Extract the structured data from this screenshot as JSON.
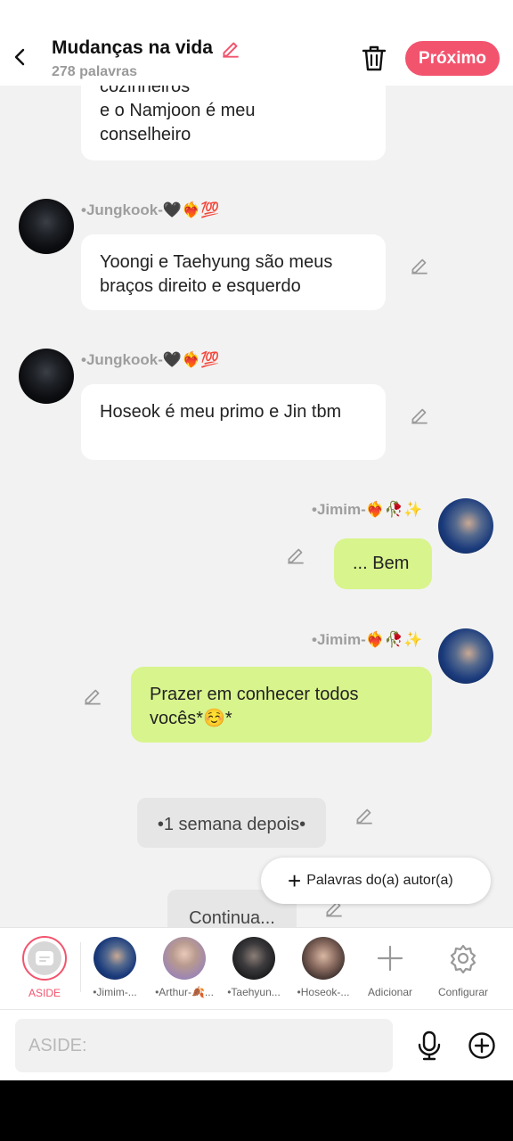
{
  "header": {
    "title": "Mudanças na vida",
    "word_count": "278 palavras",
    "next_label": "Próximo"
  },
  "messages": [
    {
      "type": "bubble",
      "side": "left",
      "text_lines": [
        "cozinheiros",
        "e o Namjoon é meu",
        "conselheiro"
      ]
    },
    {
      "type": "bubble",
      "side": "left",
      "sender": "•Jungkook-🖤❤️‍🔥💯",
      "text": "Yoongi e Taehyung são meus braços direito e esquerdo"
    },
    {
      "type": "bubble",
      "side": "left",
      "sender": "•Jungkook-🖤❤️‍🔥💯",
      "text": "Hoseok é meu primo e Jin tbm"
    },
    {
      "type": "bubble",
      "side": "right",
      "sender": "•Jimim-❤️‍🔥🥀✨",
      "text": "... Bem"
    },
    {
      "type": "bubble",
      "side": "right",
      "sender": "•Jimim-❤️‍🔥🥀✨",
      "text": "Prazer em conhecer todos vocês*☺️*"
    },
    {
      "type": "narration",
      "text": "•1 semana depois•"
    },
    {
      "type": "narration",
      "text": "Continua..."
    }
  ],
  "floating": {
    "add_author_label": "Palavras do(a) autor(a)"
  },
  "characters": [
    {
      "label": "ASIDE",
      "selected": true
    },
    {
      "label": "•Jimim-..."
    },
    {
      "label": "•Arthur-🍂..."
    },
    {
      "label": "•Taehyun..."
    },
    {
      "label": "•Hoseok-..."
    }
  ],
  "actions": {
    "add_label": "Adicionar",
    "settings_label": "Configurar"
  },
  "input": {
    "placeholder": "ASIDE:"
  },
  "colors": {
    "accent": "#f2546e",
    "my_bubble": "#d8f48c",
    "other_bubble": "#ffffff",
    "background": "#f2f2f2"
  },
  "icons": {
    "back": "chevron-left-icon",
    "title_edit": "pencil-icon",
    "delete": "trash-icon",
    "edit_message": "pencil-icon",
    "add": "plus-icon",
    "settings": "gear-icon",
    "mic": "microphone-icon",
    "attach": "plus-circle-icon"
  }
}
